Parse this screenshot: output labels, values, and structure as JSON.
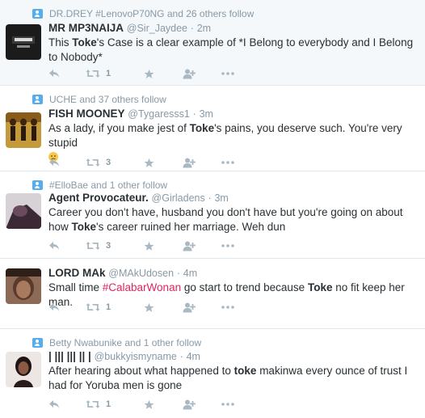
{
  "tweets": [
    {
      "context": "DR.DREY #LenovoP70NG and 26 others follow",
      "fullname": "MR MP3NAIJA",
      "username": "@Sir_Jaydee",
      "time": "2m",
      "text_parts": [
        "This ",
        "Toke",
        "'s Case is a clear example of *I Belong to everybody and I Belong to Nobody*"
      ],
      "retweets": "1",
      "highlighted": true
    },
    {
      "context": "UCHE and 37 others follow",
      "fullname": "FISH MOONEY",
      "username": "@Tygaresss1",
      "time": "3m",
      "text_parts": [
        "As a lady, if you make jest of ",
        "Toke",
        "'s pains, you deserve such. You're very stupid"
      ],
      "emoji": "confused-face-emoji",
      "retweets": "3",
      "highlighted": false
    },
    {
      "context": "#ElloBae and 1 other follow",
      "fullname": "Agent Provocateur.",
      "username": "@Girladens",
      "time": "3m",
      "text_parts": [
        "Career you don't have, husband you don't have but you're going on about how ",
        "Toke",
        "'s career ruined her marriage. Weh dun"
      ],
      "retweets": "3",
      "highlighted": false
    },
    {
      "fullname": "LORD MAk",
      "username": "@MAkUdosen",
      "time": "4m",
      "text_parts": [
        "Small time ",
        "#CalabarWonan",
        " go start to trend because ",
        "Toke",
        " no fit keep her man."
      ],
      "retweets": "1",
      "highlighted": false
    },
    {
      "context": "Betty Nwabunike and 1 other follow",
      "fullname": "| ||| ||| || |",
      "username": "@bukkyismyname",
      "time": "4m",
      "text_parts": [
        "After hearing about what happened to ",
        "toke",
        " makinwa every ounce of trust I had for Yoruba men is gone"
      ],
      "retweets": "1",
      "highlighted": false
    }
  ],
  "separator": "·",
  "colors": {
    "accent": "#55acee",
    "hashtag": "#e0245e",
    "muted": "#8899a6",
    "icon": "#aab8c2"
  }
}
